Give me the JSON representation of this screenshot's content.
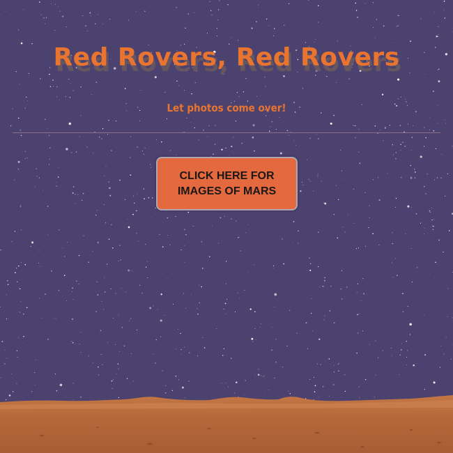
{
  "header": {
    "title": "Red Rovers, Red Rovers",
    "subtitle": "Let photos come over!"
  },
  "main": {
    "cta_label": "CLICK HERE FOR IMAGES OF MARS"
  },
  "colors": {
    "sky": "#4b426f",
    "accent_orange": "#e8742f",
    "button_fill": "#e5693f",
    "mars_ground": "#b9693a"
  },
  "icons": {
    "background": "starfield",
    "foreground": "mars-terrain"
  }
}
